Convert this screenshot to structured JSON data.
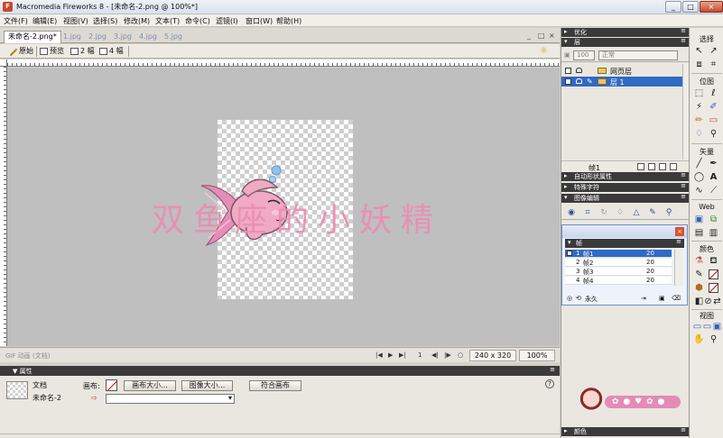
{
  "window": {
    "title": "Macromedia Fireworks 8 - [未命名-2.png @ 100%*]",
    "app_icon": "fireworks-icon",
    "controls": [
      "_",
      "□",
      "×"
    ]
  },
  "menubar": [
    "文件(F)",
    "编辑(E)",
    "视图(V)",
    "选择(S)",
    "修改(M)",
    "文本(T)",
    "命令(C)",
    "滤镜(I)",
    "窗口(W)",
    "帮助(H)"
  ],
  "document_tabs": {
    "active": "未命名-2.png*",
    "others": [
      "1.jpg",
      "2.jpg",
      "3.jpg",
      "4.jpg",
      "5.jpg"
    ],
    "controls": [
      "_",
      "□",
      "×"
    ]
  },
  "view_bar": {
    "original": "原始",
    "preview": "预览",
    "two_up": "2 幅",
    "four_up": "4 幅"
  },
  "canvas": {
    "watermark": "双鱼座的小妖精",
    "doc_size": "240 x 320",
    "zoom": "100%",
    "format_hint": "GIF 动画 (文档)",
    "frame_number": "1"
  },
  "properties": {
    "header": "▼ 属性",
    "doc_label": "文档",
    "doc_name": "未命名-2",
    "canvas_label": "画布:",
    "canvas_size_button": "画布大小...",
    "image_size_button": "图像大小...",
    "fit_canvas_button": "符合画布",
    "help": "?"
  },
  "panels": {
    "optimize": "优化",
    "layers": "层",
    "opacity": "100",
    "blend_mode": "正常",
    "layer_rows": [
      {
        "name": "网页层",
        "selected": false
      },
      {
        "name": "层 1",
        "selected": true
      }
    ],
    "frame_footer": "帧1",
    "autoshape": "自动形状属性",
    "special_chars": "特殊字符",
    "image_edit": "图像编辑",
    "frames_header": "帧",
    "frames": [
      {
        "n": "1",
        "name": "帧1",
        "delay": "20",
        "selected": true
      },
      {
        "n": "2",
        "name": "帧2",
        "delay": "20",
        "selected": false
      },
      {
        "n": "3",
        "name": "帧3",
        "delay": "20",
        "selected": false
      },
      {
        "n": "4",
        "name": "帧4",
        "delay": "20",
        "selected": false
      }
    ],
    "loop": "永久",
    "color_panel": "颜色"
  },
  "toolbar": {
    "select": "选择",
    "bitmap": "位图",
    "vector": "矢量",
    "web": "Web",
    "colors": "颜色",
    "view": "视图"
  },
  "colors": {
    "watermark": "#ec8db2",
    "selection": "#316ac5",
    "panel_header": "#3a3a3a"
  }
}
